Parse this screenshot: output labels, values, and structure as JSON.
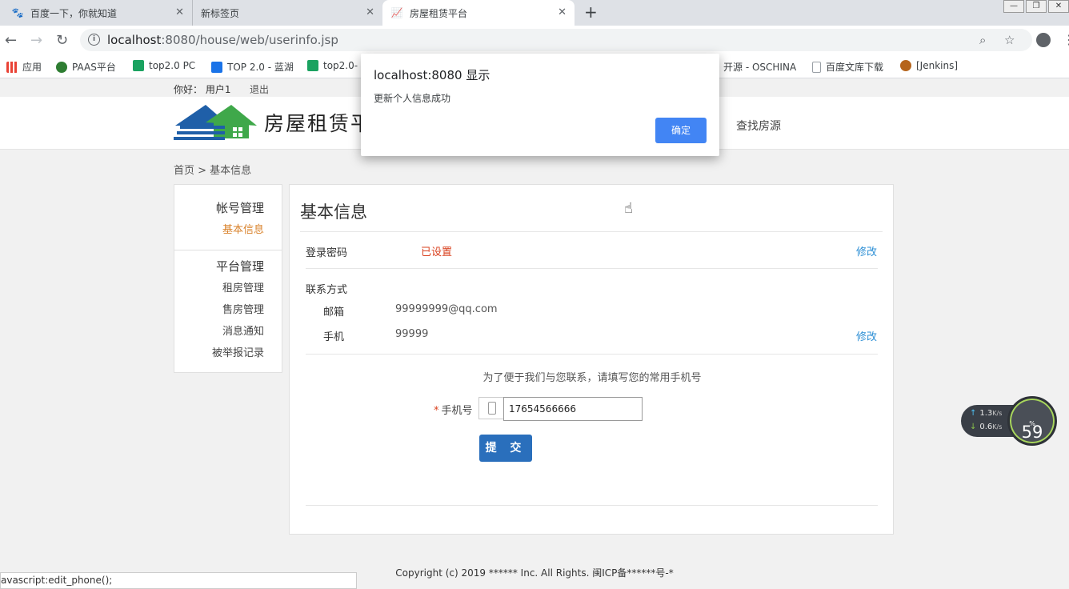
{
  "browser": {
    "tabs": [
      {
        "title": "百度一下，你就知道",
        "icon": "baidu-paw-icon"
      },
      {
        "title": "新标签页",
        "icon": "none"
      },
      {
        "title": "房屋租赁平台",
        "icon": "chart-icon",
        "active": true
      }
    ],
    "url_host": "localhost",
    "url_rest": ":8080/house/web/userinfo.jsp",
    "bookmarks": [
      {
        "label": "应用",
        "color": "#e94235"
      },
      {
        "label": "PAAS平台",
        "color": "#2e7d32"
      },
      {
        "label": "top2.0 PC",
        "color": "#1aa260"
      },
      {
        "label": "TOP 2.0 - 蓝湖",
        "color": "#1a73e8"
      },
      {
        "label": "top2.0-",
        "color": "#1aa260"
      },
      {
        "label": "开源 - OSCHINA",
        "color": "#2e7d32"
      },
      {
        "label": "百度文库下载",
        "color": "#9aa0a6"
      },
      {
        "label": "[Jenkins]",
        "color": "#b5651d"
      }
    ],
    "status_text": "avascript:edit_phone();"
  },
  "site": {
    "greeting": "你好： 用户1",
    "logout": "退出",
    "logo_text": "房屋租赁平",
    "nav_find": "查找房源",
    "breadcrumb": "首页 > 基本信息",
    "footer": "Copyright (c) 2019 ****** Inc. All Rights. 闽ICP备******号-*"
  },
  "sidebar": {
    "group1": "帐号管理",
    "group1_items": [
      "基本信息"
    ],
    "group2": "平台管理",
    "group2_items": [
      "租房管理",
      "售房管理",
      "消息通知",
      "被举报记录"
    ]
  },
  "main": {
    "title": "基本信息",
    "password_label": "登录密码",
    "password_status": "已设置",
    "edit_label": "修改",
    "contact_label": "联系方式",
    "email_label": "邮箱",
    "email_value": "99999999@qq.com",
    "phone_label": "手机",
    "phone_value": "99999",
    "hint": "为了便于我们与您联系，请填写您的常用手机号",
    "phone_field_label": "手机号",
    "phone_input_value": "17654566666",
    "submit": "提 交"
  },
  "dialog": {
    "title": "localhost:8080 显示",
    "message": "更新个人信息成功",
    "ok": "确定"
  },
  "widget": {
    "up_value": "1.3",
    "down_value": "0.6",
    "unit": "K/s",
    "percent": "59",
    "percent_sign": "%"
  }
}
